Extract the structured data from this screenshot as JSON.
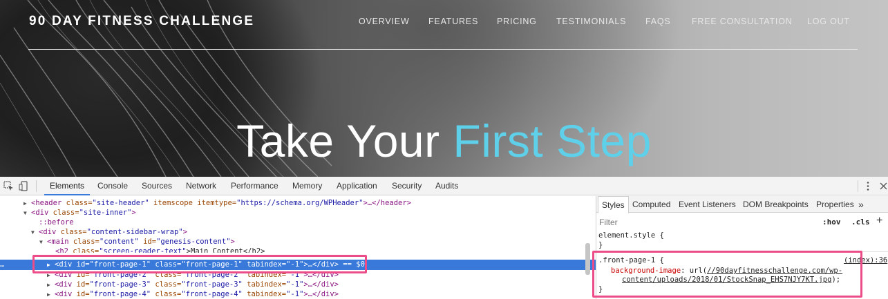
{
  "hero": {
    "logo": "90 DAY FITNESS CHALLENGE",
    "nav": [
      {
        "label": "OVERVIEW"
      },
      {
        "label": "FEATURES"
      },
      {
        "label": "PRICING"
      },
      {
        "label": "TESTIMONIALS"
      },
      {
        "label": "FAQS"
      },
      {
        "label": "FREE CONSULTATION"
      },
      {
        "label": "LOG OUT"
      }
    ],
    "headline_main": "Take Your ",
    "headline_accent": "First Step",
    "accent_color": "#5fd0ea"
  },
  "devtools": {
    "tabs": [
      {
        "label": "Elements"
      },
      {
        "label": "Console"
      },
      {
        "label": "Sources"
      },
      {
        "label": "Network"
      },
      {
        "label": "Performance"
      },
      {
        "label": "Memory"
      },
      {
        "label": "Application"
      },
      {
        "label": "Security"
      },
      {
        "label": "Audits"
      }
    ],
    "active_tab": "Elements",
    "dom": {
      "l1": {
        "open": "<header",
        "a1n": " class=",
        "a1v": "\"site-header\"",
        "a2n": " itemscope itemtype=",
        "a2v": "\"https://schema.org/WPHeader\"",
        "close": ">…</header>"
      },
      "l2": {
        "open": "<div",
        "a1n": " class=",
        "a1v": "\"site-inner\"",
        "close": ">"
      },
      "l3": {
        "text": "::before"
      },
      "l4": {
        "open": "<div",
        "a1n": " class=",
        "a1v": "\"content-sidebar-wrap\"",
        "close": ">"
      },
      "l5": {
        "open": "<main",
        "a1n": " class=",
        "a1v": "\"content\"",
        "a2n": " id=",
        "a2v": "\"genesis-content\"",
        "close": ">"
      },
      "l6": {
        "open": "<h2",
        "a1n": " class=",
        "a1v": "\"screen-reader-text\"",
        "text": ">Main Content</h2>"
      },
      "l7": {
        "open": "<div",
        "a1n": " id=",
        "a1v": "\"front-page-1\"",
        "a2n": " class=",
        "a2v": "\"front-page-1\"",
        "a3n": " tabindex=",
        "a3v": "\"-1\"",
        "close": ">…</div>",
        "marker": " == $0"
      },
      "l8": {
        "open": "<div",
        "a1n": " id=",
        "a1v": "\"front-page-2\"",
        "a2n": " class=",
        "a2v": "\"front-page-2\"",
        "a3n": " tabindex=",
        "a3v": "\"-1\"",
        "close": ">…</div>"
      },
      "l9": {
        "open": "<div",
        "a1n": " id=",
        "a1v": "\"front-page-3\"",
        "a2n": " class=",
        "a2v": "\"front-page-3\"",
        "a3n": " tabindex=",
        "a3v": "\"-1\"",
        "close": ">…</div>"
      },
      "l10": {
        "open": "<div",
        "a1n": " id=",
        "a1v": "\"front-page-4\"",
        "a2n": " class=",
        "a2v": "\"front-page-4\"",
        "a3n": " tabindex=",
        "a3v": "\"-1\"",
        "close": ">…</div>"
      }
    },
    "styles": {
      "tabs": [
        {
          "label": "Styles"
        },
        {
          "label": "Computed"
        },
        {
          "label": "Event Listeners"
        },
        {
          "label": "DOM Breakpoints"
        },
        {
          "label": "Properties"
        },
        {
          "label": "»"
        }
      ],
      "filter_placeholder": "Filter",
      "hov": ":hov",
      "cls": ".cls",
      "plus": "+",
      "element_style_open": "element.style {",
      "element_style_close": "}",
      "rule_selector": ".front-page-1 {",
      "rule_source": "(index):36",
      "rule_prop": "background-image",
      "rule_colon": ": url(",
      "rule_url_1": "//90dayfitnesschallenge.com/wp-",
      "rule_url_2": "content/uploads/2018/01/StockSnap_EHS7NJY7KT.jpg",
      "rule_end": ");",
      "rule_close": "}"
    },
    "highlight_color": "#ec4d89"
  }
}
